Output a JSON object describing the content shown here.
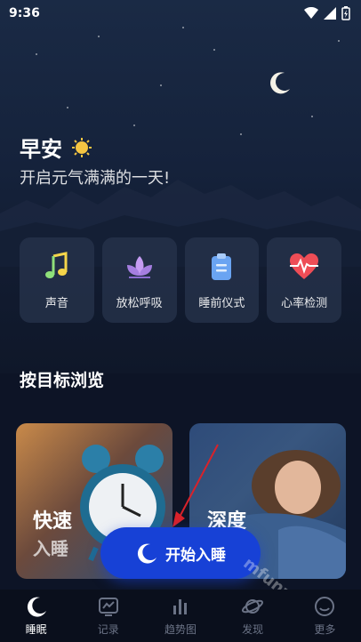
{
  "status_bar": {
    "time": "9:36"
  },
  "greeting": {
    "title": "早安",
    "subtitle": "开启元气满满的一天!"
  },
  "quick_actions": [
    {
      "label": "声音",
      "icon": "music-note-icon"
    },
    {
      "label": "放松呼吸",
      "icon": "lotus-icon"
    },
    {
      "label": "睡前仪式",
      "icon": "clipboard-icon"
    },
    {
      "label": "心率检测",
      "icon": "heartbeat-icon"
    }
  ],
  "browse": {
    "title": "按目标浏览",
    "cards": [
      {
        "title": "快速",
        "subtitle": "入睡"
      },
      {
        "title": "深度",
        "subtitle": ""
      }
    ]
  },
  "start_button": {
    "label": "开始入睡"
  },
  "watermark": "mfunz.com 魔趣网",
  "tabs": [
    {
      "label": "睡眠",
      "icon": "moon-icon",
      "active": true
    },
    {
      "label": "记录",
      "icon": "chart-screen-icon",
      "active": false
    },
    {
      "label": "趋势图",
      "icon": "bar-chart-icon",
      "active": false
    },
    {
      "label": "发现",
      "icon": "planet-icon",
      "active": false
    },
    {
      "label": "更多",
      "icon": "more-icon",
      "active": false
    }
  ],
  "colors": {
    "accent": "#1741d6",
    "background": "#0d1426",
    "tab_bar": "#0a0f1c"
  }
}
